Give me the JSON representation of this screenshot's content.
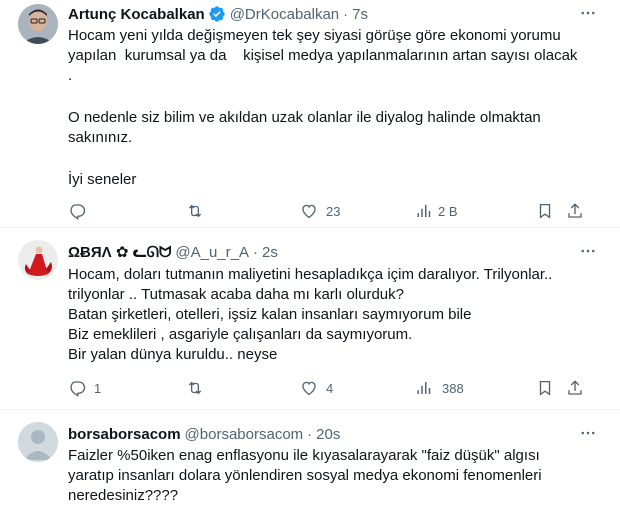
{
  "tweets": [
    {
      "name": "Artunç Kocabalkan",
      "handle": "@DrKocabalkan",
      "separator": "·",
      "time": "7s",
      "verified": true,
      "lines": [
        "Hocam yeni yılda değişmeyen tek şey siyasi görüşe göre ekonomi yorumu",
        "yapılan  kurumsal ya da    kişisel medya yapılanmalarının artan sayısı olacak",
        ".",
        "",
        "O nedenle siz bilim ve akıldan uzak olanlar ile diyalog halinde olmaktan",
        "sakınınız.",
        "",
        "İyi seneler"
      ],
      "actions": {
        "replies": "",
        "retweets": "",
        "likes": "23",
        "views": "2 B"
      },
      "avatar_icon": "profile-photo"
    },
    {
      "name": "ΩɃЯΛ ✿ ᓚᘏᗢ",
      "handle": "@A_u_r_A",
      "separator": "·",
      "time": "2s",
      "verified": false,
      "lines": [
        "Hocam, doları tutmanın maliyetini hesapladıkça içim daralıyor. Trilyonlar..",
        "trilyonlar .. Tutmasak acaba daha mı karlı olurduk?",
        "Batan şirketleri, otelleri, işsiz kalan insanları saymıyorum bile",
        "Biz emeklileri , asgariyle çalışanları da saymıyorum.",
        "Bir yalan dünya kuruldu.. neyse"
      ],
      "actions": {
        "replies": "1",
        "retweets": "",
        "likes": "4",
        "views": "388"
      },
      "avatar_icon": "red-dress-figure"
    },
    {
      "name": "borsaborsacom",
      "handle": "@borsaborsacom",
      "separator": "·",
      "time": "20s",
      "verified": false,
      "lines": [
        "Faizler %50iken enag enflasyonu ile kıyasalarayarak \"faiz düşük\" algısı",
        "yaratıp insanları dolara yönlendiren sosyal medya ekonomi fenomenleri",
        "neredesiniz????"
      ],
      "actions": null,
      "avatar_icon": "default-avatar"
    }
  ],
  "colors": {
    "text": "#0f1419",
    "secondary": "#536471",
    "verified": "#1d9bf0",
    "divider": "#eff3f4"
  },
  "icons": [
    "reply-icon",
    "retweet-icon",
    "like-icon",
    "views-icon",
    "bookmark-icon",
    "share-icon",
    "more-icon",
    "verified-icon"
  ]
}
